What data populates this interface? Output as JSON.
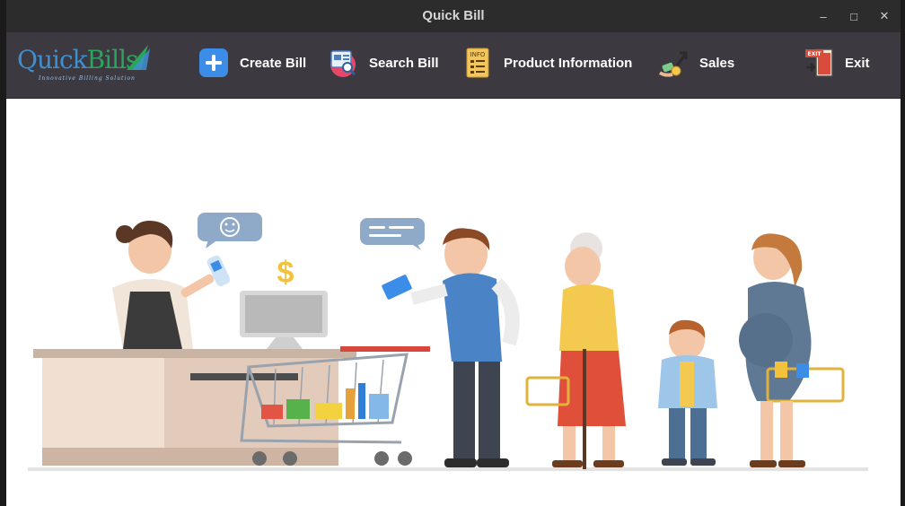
{
  "window": {
    "title": "Quick Bill"
  },
  "window_controls": {
    "minimize": "–",
    "maximize": "□",
    "close": "✕"
  },
  "logo": {
    "brand_part1": "Quick",
    "brand_part2": "Bills",
    "tagline": "Innovative Billing Solution"
  },
  "toolbar": {
    "create_bill": {
      "label": "Create Bill",
      "icon": "plus-icon"
    },
    "search_bill": {
      "label": "Search Bill",
      "icon": "search-document-icon"
    },
    "product_info": {
      "label": "Product Information",
      "icon": "info-document-icon",
      "icon_text": "INFO"
    },
    "sales": {
      "label": "Sales",
      "icon": "sales-chart-icon"
    },
    "exit": {
      "label": "Exit",
      "icon": "exit-door-icon",
      "icon_text": "EXIT"
    }
  },
  "illustration": {
    "description_icon": "supermarket-checkout-illustration",
    "currency_symbol": "$"
  },
  "colors": {
    "titlebar": "#2c2c2c",
    "toolbar": "#3c3940",
    "accent_blue": "#3b8de8",
    "content_bg": "#ffffff"
  }
}
